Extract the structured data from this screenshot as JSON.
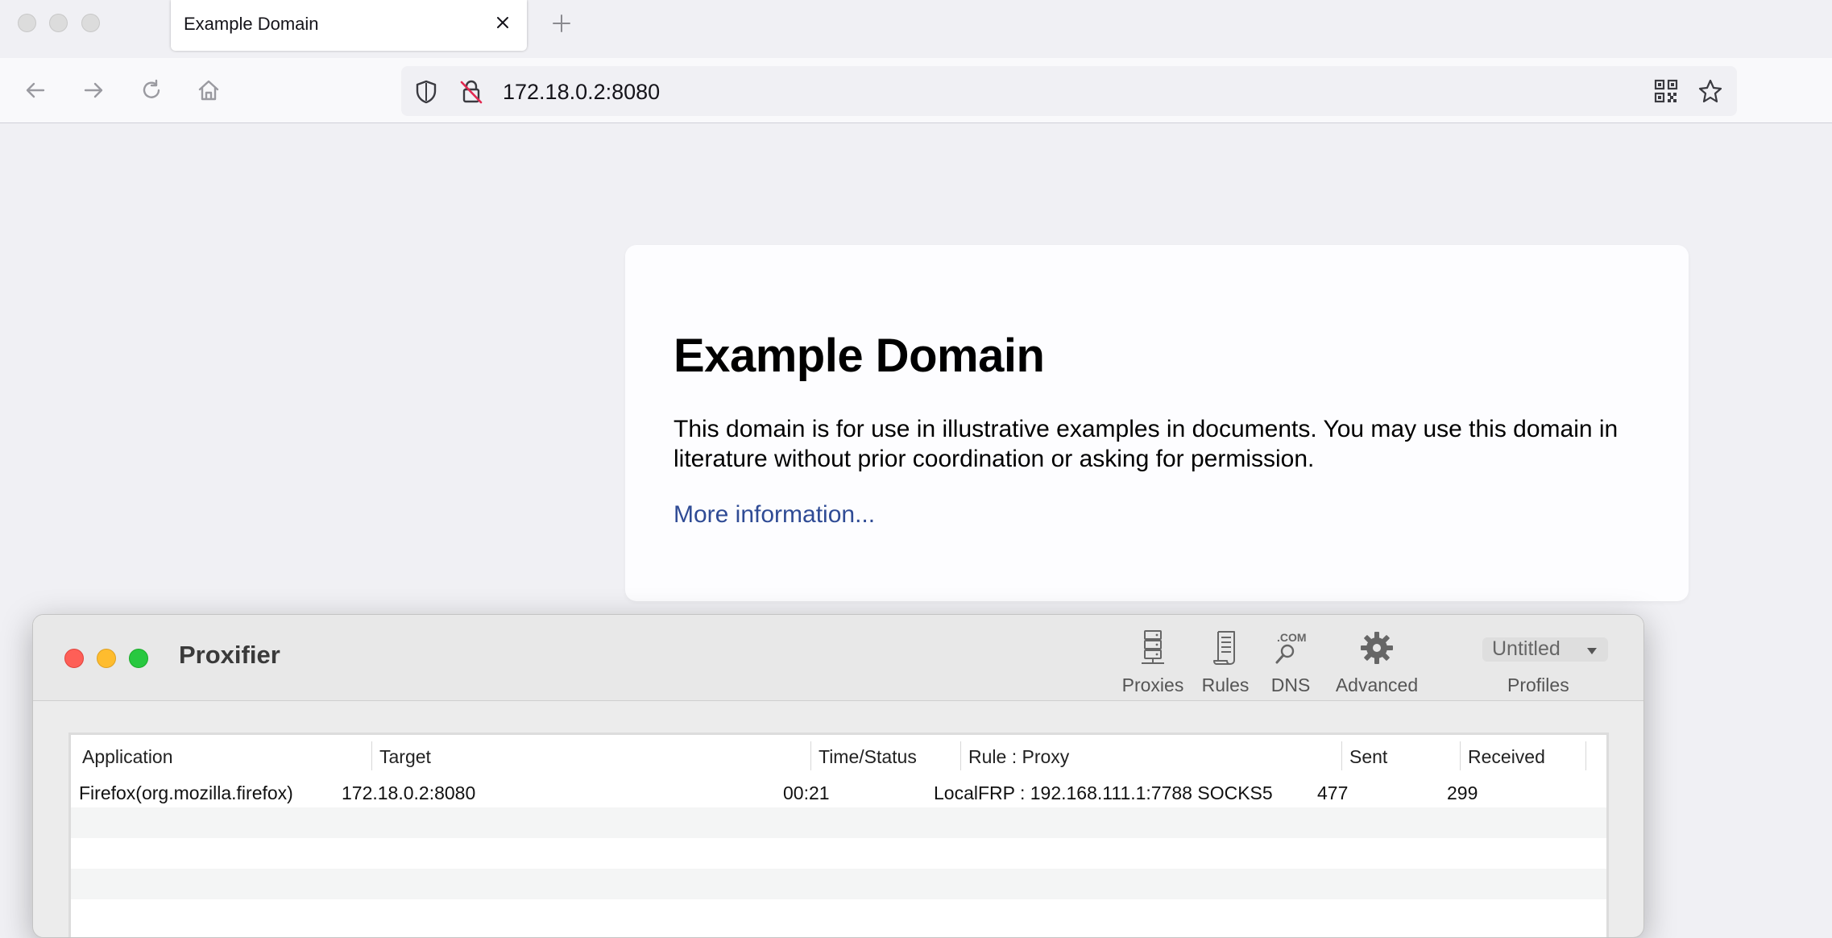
{
  "browser": {
    "tab_title": "Example Domain",
    "url": "172.18.0.2:8080"
  },
  "page": {
    "title": "Example Domain",
    "body": "This domain is for use in illustrative examples in documents. You may use this domain in literature without prior coordination or asking for permission.",
    "link": "More information..."
  },
  "proxifier": {
    "title": "Proxifier",
    "toolbar": {
      "proxies": "Proxies",
      "rules": "Rules",
      "dns": "DNS",
      "dns_badge": ".COM",
      "advanced": "Advanced",
      "profile_name": "Untitled",
      "profiles": "Profiles"
    },
    "columns": [
      "Application",
      "Target",
      "Time/Status",
      "Rule : Proxy",
      "Sent",
      "Received"
    ],
    "rows": [
      {
        "application": "Firefox(org.mozilla.firefox)",
        "target": "172.18.0.2:8080",
        "time": "00:21",
        "rule": "LocalFRP : 192.168.111.1:7788 SOCKS5",
        "sent": "477",
        "received": "299"
      }
    ]
  },
  "colors": {
    "link": "#2f4b95",
    "close_light": "#fe5f57",
    "minimize_light": "#febc2e",
    "zoom_light": "#28c840"
  }
}
